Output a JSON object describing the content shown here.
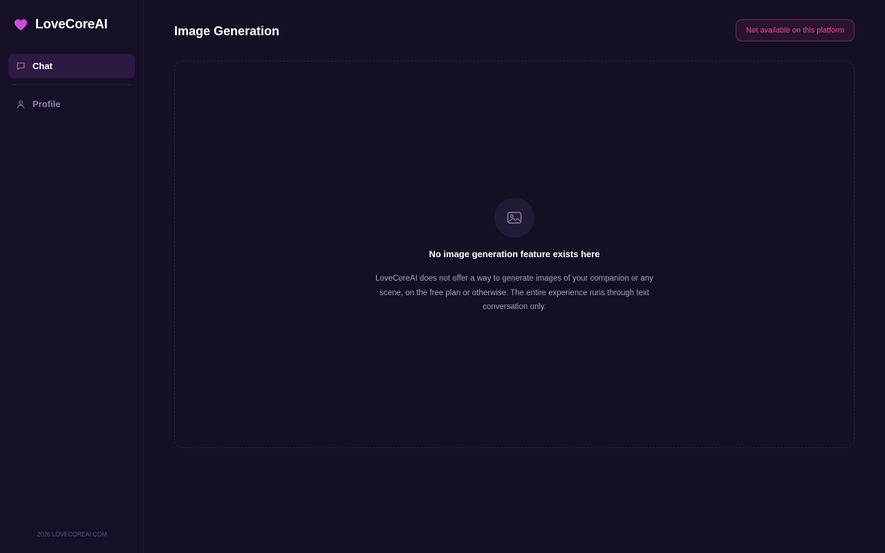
{
  "brand": {
    "name": "LoveCoreAI",
    "icon": "heart-icon",
    "icon_color": "#c64fd6"
  },
  "sidebar": {
    "items": [
      {
        "label": "Chat",
        "icon": "chat-bubble-icon",
        "active": true
      },
      {
        "label": "Profile",
        "icon": "user-icon",
        "active": false
      }
    ],
    "footer": "2026 LOVECOREAI.COM"
  },
  "main": {
    "title": "Image Generation",
    "status_badge": "Not available on this platform",
    "empty_state": {
      "icon": "image-icon",
      "title": "No image generation feature exists here",
      "description": "LoveCoreAI does not offer a way to generate images of your companion or any scene, on the free plan or otherwise. The entire experience runs through text conversation only."
    }
  },
  "colors": {
    "background": "#150f24",
    "accent": "#e0508e",
    "active_nav": "#2d1a42"
  }
}
